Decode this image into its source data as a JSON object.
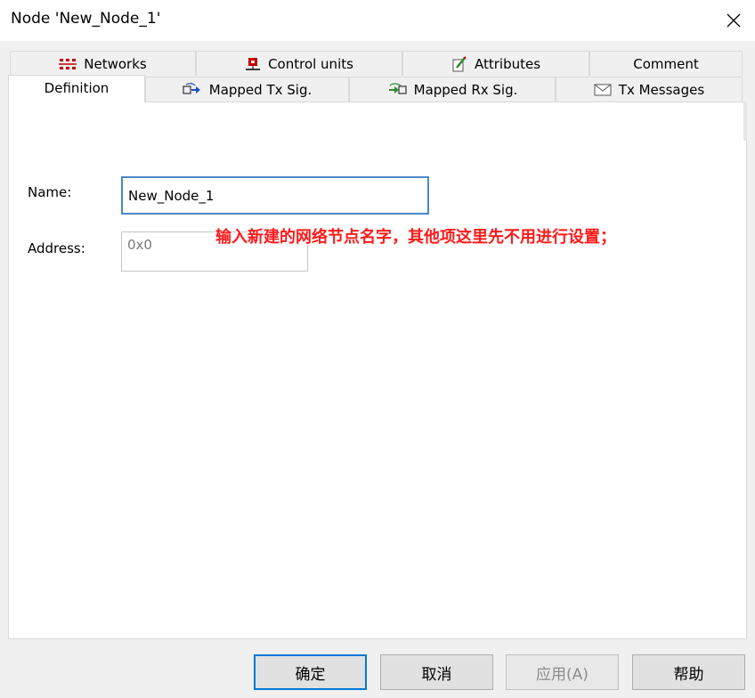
{
  "window": {
    "title": "Node 'New_Node_1'",
    "close_icon": "close-icon"
  },
  "tabs_row1": [
    {
      "label": "Networks",
      "icon": "networks-icon"
    },
    {
      "label": "Control units",
      "icon": "control-units-icon"
    },
    {
      "label": "Attributes",
      "icon": "attributes-icon"
    },
    {
      "label": "Comment",
      "icon": ""
    }
  ],
  "tabs_row2": [
    {
      "label": "Definition",
      "icon": "",
      "active": true
    },
    {
      "label": "Mapped Tx Sig.",
      "icon": "mapped-tx-icon"
    },
    {
      "label": "Mapped Rx Sig.",
      "icon": "mapped-rx-icon"
    },
    {
      "label": "Tx Messages",
      "icon": "envelope-icon"
    }
  ],
  "form": {
    "name_label": "Name:",
    "name_value": "New_Node_1",
    "address_label": "Address:",
    "address_value": "0x0"
  },
  "annotation": "输入新建的网络节点名字，其他项这里先不用进行设置；",
  "buttons": {
    "ok": "确定",
    "cancel": "取消",
    "apply": "应用(A)",
    "help": "帮助"
  },
  "colors": {
    "accent": "#0078d7",
    "annotation": "#ff1a1a",
    "focus_border": "#4a89c8"
  }
}
